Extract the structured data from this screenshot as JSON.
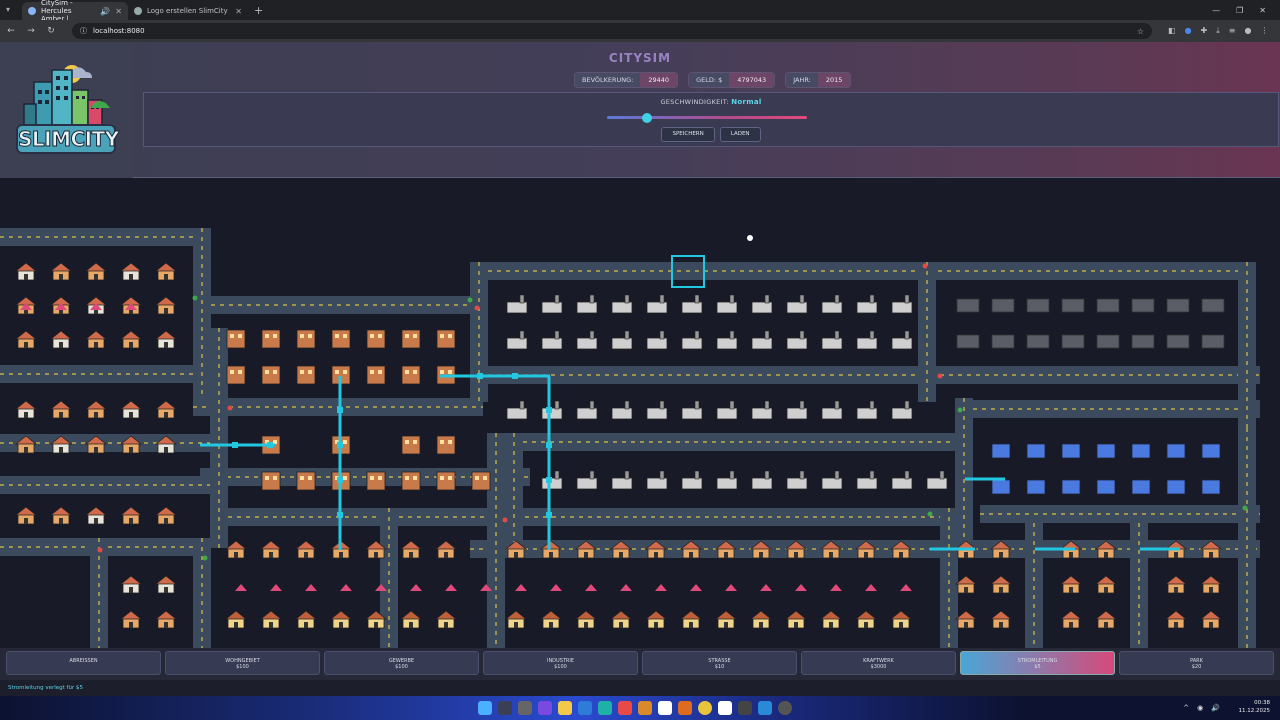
{
  "browser": {
    "tabs": [
      {
        "title": "CitySim - Hercules Amber |",
        "active": true
      },
      {
        "title": "Logo erstellen SlimCity",
        "active": false
      }
    ],
    "url": "localhost:8080"
  },
  "header": {
    "logo_text": "SLIMCITY",
    "title": "CITYSIM",
    "stats": [
      {
        "label": "BEVÖLKERUNG:",
        "value": "29440"
      },
      {
        "label": "GELD: $",
        "value": "4797043"
      },
      {
        "label": "JAHR:",
        "value": "2015"
      }
    ],
    "speed_label": "GESCHWINDIGKEIT:",
    "speed_value": "Normal",
    "speed_level": 0.2,
    "save_label": "SPEICHERN",
    "load_label": "LADEN"
  },
  "tools": [
    {
      "name": "ABREISSEN",
      "price": ""
    },
    {
      "name": "WOHNGEBIET",
      "price": "$100"
    },
    {
      "name": "GEWERBE",
      "price": "$100"
    },
    {
      "name": "INDUSTRIE",
      "price": "$100"
    },
    {
      "name": "STRASSE",
      "price": "$10"
    },
    {
      "name": "KRAFTWERK",
      "price": "$3000"
    },
    {
      "name": "STROMLEITUNG",
      "price": "$5",
      "active": true
    },
    {
      "name": "PARK",
      "price": "$20"
    }
  ],
  "status": "Stromleitung verlegt für $5",
  "taskbar": {
    "time": "00:38",
    "date": "11.12.2025"
  },
  "colors": {
    "road": "#3b4a5c",
    "lane": "#d8c24a",
    "power": "#22c8e0",
    "house": "#e8a868",
    "roof": "#d06a4a",
    "industry": "#cfcfcf",
    "powerplant": "#4a7ae0",
    "active_tool": "#d64a7a"
  }
}
